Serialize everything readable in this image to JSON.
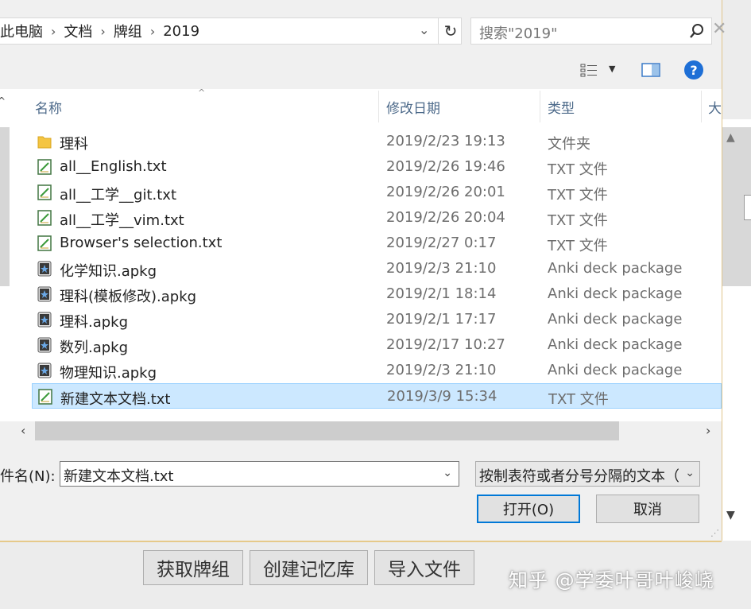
{
  "breadcrumb": [
    "此电脑",
    "文档",
    "牌组",
    "2019"
  ],
  "search": {
    "placeholder": "搜索\"2019\""
  },
  "columns": {
    "name": "名称",
    "date": "修改日期",
    "type": "类型",
    "size": "大"
  },
  "files": [
    {
      "name": "理科",
      "date": "2019/2/23 19:13",
      "type": "文件夹",
      "icon": "folder-icon"
    },
    {
      "name": "all__English.txt",
      "date": "2019/2/26 19:46",
      "type": "TXT 文件",
      "icon": "text-file-icon"
    },
    {
      "name": "all__工学__git.txt",
      "date": "2019/2/26 20:01",
      "type": "TXT 文件",
      "icon": "text-file-icon"
    },
    {
      "name": "all__工学__vim.txt",
      "date": "2019/2/26 20:04",
      "type": "TXT 文件",
      "icon": "text-file-icon"
    },
    {
      "name": "Browser's selection.txt",
      "date": "2019/2/27 0:17",
      "type": "TXT 文件",
      "icon": "text-file-icon"
    },
    {
      "name": "化学知识.apkg",
      "date": "2019/2/3 21:10",
      "type": "Anki deck package",
      "icon": "anki-file-icon"
    },
    {
      "name": "理科(模板修改).apkg",
      "date": "2019/2/1 18:14",
      "type": "Anki deck package",
      "icon": "anki-file-icon"
    },
    {
      "name": "理科.apkg",
      "date": "2019/2/1 17:17",
      "type": "Anki deck package",
      "icon": "anki-file-icon"
    },
    {
      "name": "数列.apkg",
      "date": "2019/2/17 10:27",
      "type": "Anki deck package",
      "icon": "anki-file-icon"
    },
    {
      "name": "物理知识.apkg",
      "date": "2019/2/3 21:10",
      "type": "Anki deck package",
      "icon": "anki-file-icon"
    },
    {
      "name": "新建文本文档.txt",
      "date": "2019/3/9 15:34",
      "type": "TXT 文件",
      "icon": "text-file-icon",
      "selected": true
    }
  ],
  "filename": {
    "label": "件名(N):",
    "value": "新建文本文档.txt"
  },
  "filter": {
    "value": "按制表符或者分号分隔的文本（"
  },
  "buttons": {
    "open": "打开(O)",
    "cancel": "取消"
  },
  "background_buttons": [
    "获取牌组",
    "创建记忆库",
    "导入文件"
  ],
  "watermark": "知乎 @学委叶哥叶峻峣",
  "colors": {
    "accent": "#0078d7",
    "selection": "#cce8ff",
    "header_text": "#4d6a8a"
  }
}
